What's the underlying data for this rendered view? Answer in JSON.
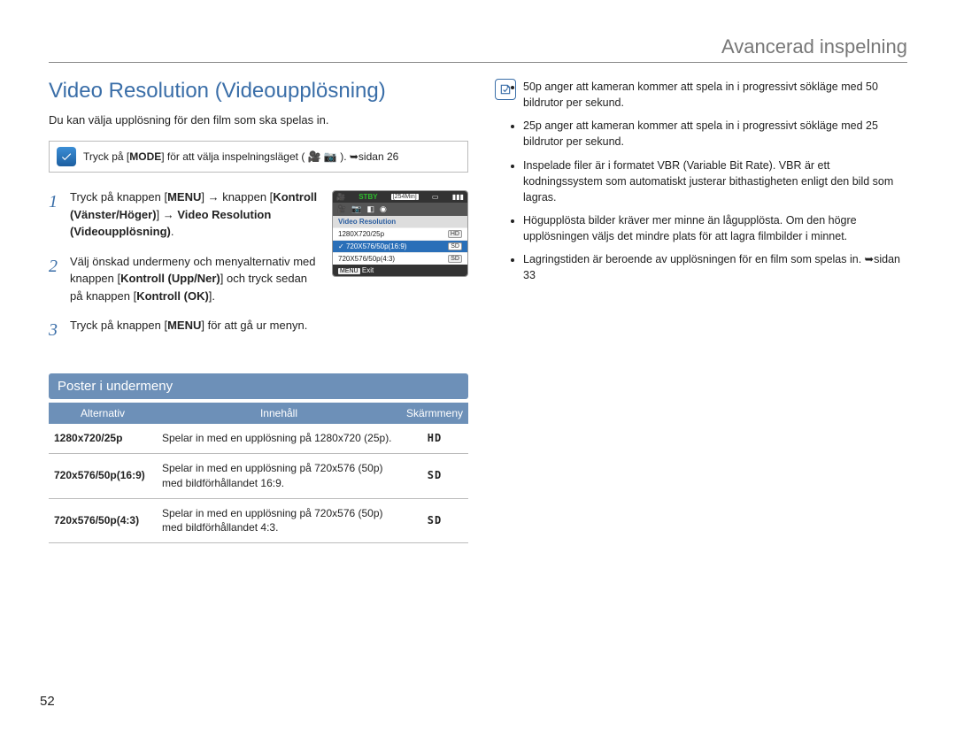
{
  "header": {
    "chapter": "Avancerad inspelning"
  },
  "title": "Video Resolution (Videoupplösning)",
  "intro": "Du kan välja upplösning för den film som ska spelas in.",
  "tip": {
    "prefix": "Tryck på [",
    "mode": "MODE",
    "suffix": "] för att välja inspelningsläget ( 🎥 📷 ). ➥sidan 26"
  },
  "steps": [
    {
      "num": "1",
      "html": "Tryck på knappen [<b>MENU</b>] → knappen [<b>Kontroll (Vänster/Höger)</b>] → <b>Video Resolution (Videoupplösning)</b>."
    },
    {
      "num": "2",
      "html": "Välj önskad undermeny och menyalternativ med knappen [<b>Kontroll (Upp/Ner)</b>] och tryck sedan på knappen [<b>Kontroll (OK)</b>]."
    },
    {
      "num": "3",
      "html": "Tryck på knappen [<b>MENU</b>] för att gå ur menyn."
    }
  ],
  "lcd": {
    "stby": "STBY",
    "time": "[254Min]",
    "menu_title": "Video Resolution",
    "items": [
      {
        "label": "1280X720/25p",
        "badge": "HD",
        "selected": false
      },
      {
        "label": "720X576/50p(16:9)",
        "badge": "SD",
        "selected": true
      },
      {
        "label": "720X576/50p(4:3)",
        "badge": "SD",
        "selected": false
      }
    ],
    "exit_prefix": "MENU",
    "exit_label": "Exit"
  },
  "subsection_title": "Poster i undermeny",
  "table": {
    "headers": {
      "c1": "Alternativ",
      "c2": "Innehåll",
      "c3": "Skärmmeny"
    },
    "rows": [
      {
        "alt": "1280x720/25p",
        "desc": "Spelar in med en upplösning på 1280x720 (25p).",
        "disp": "HD"
      },
      {
        "alt": "720x576/50p(16:9)",
        "desc": "Spelar in med en upplösning på 720x576 (50p) med bildförhållandet 16:9.",
        "disp": "SD"
      },
      {
        "alt": "720x576/50p(4:3)",
        "desc": "Spelar in med en upplösning på 720x576 (50p) med bildförhållandet 4:3.",
        "disp": "SD"
      }
    ]
  },
  "notes": [
    "50p anger att kameran kommer att spela in i progressivt sökläge med 50 bildrutor per sekund.",
    "25p anger att kameran kommer att spela in i progressivt sökläge med 25 bildrutor per sekund.",
    "Inspelade filer är i formatet VBR (Variable Bit Rate). VBR är ett kodningssystem som automatiskt justerar bithastigheten enligt den bild som lagras.",
    "Högupplösta bilder kräver mer minne än lågupplösta. Om den högre upplösningen väljs det mindre plats för att lagra filmbilder i minnet.",
    "Lagringstiden är beroende av upplösningen för en film som spelas in. ➥sidan 33"
  ],
  "page_number": "52"
}
